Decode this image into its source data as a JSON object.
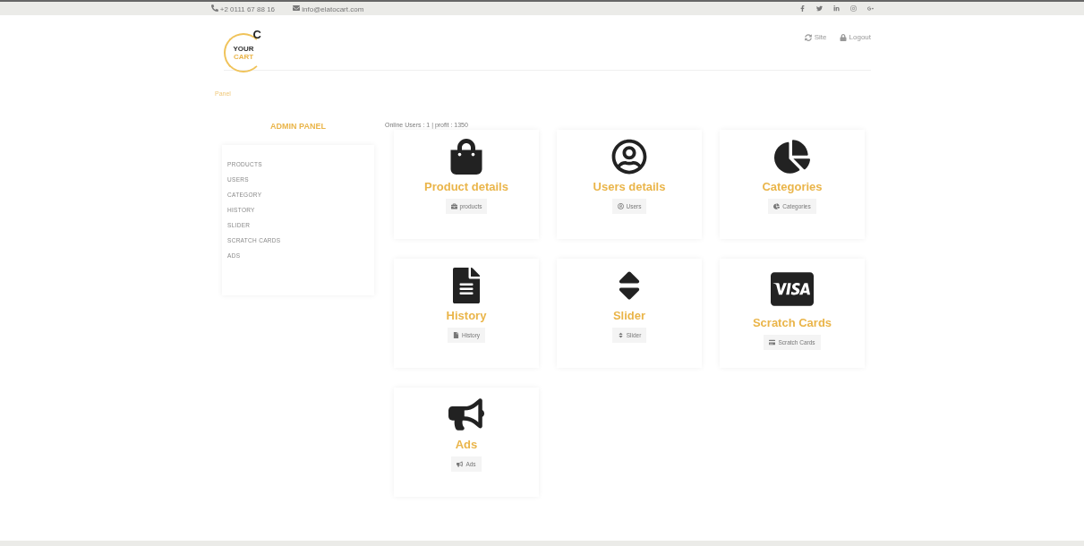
{
  "top_bar": {
    "phone": "+2 0111 67 88 16",
    "email": "info@elatocart.com"
  },
  "logo": {
    "letter": "C",
    "line_1": "YOUR",
    "line_2": "CART"
  },
  "nav": [
    "Site",
    "Logout"
  ],
  "breadcrumb": "Panel",
  "sidebar": {
    "title": "ADMIN PANEL",
    "items": [
      "PRODUCTS",
      "USERS",
      "CATEGORY",
      "HISTORY",
      "SLIDER",
      "SCRATCH CARDS",
      "ADS"
    ]
  },
  "stats": "Online Users : 1 | profit : 1350",
  "cards": [
    {
      "title": "Product details",
      "button": "products"
    },
    {
      "title": "Users details",
      "button": "Users"
    },
    {
      "title": "Categories",
      "button": "Categories"
    },
    {
      "title": "History",
      "button": "History"
    },
    {
      "title": "Slider",
      "button": "Slider"
    },
    {
      "title": "Scratch Cards",
      "button": "Scratch Cards"
    },
    {
      "title": "Ads",
      "button": "Ads"
    }
  ]
}
